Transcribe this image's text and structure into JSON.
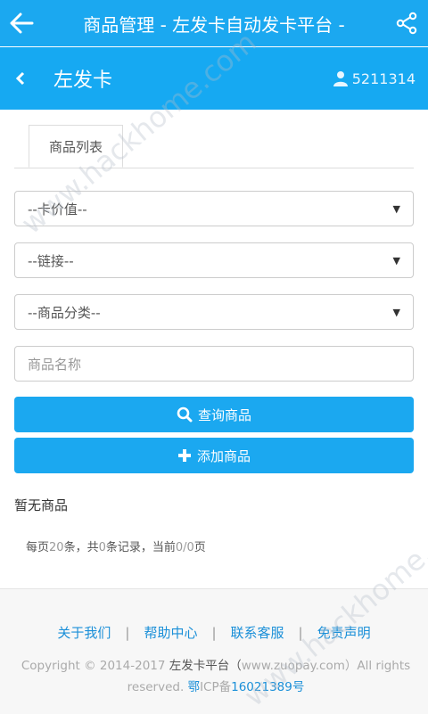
{
  "topbar": {
    "title": "商品管理 - 左发卡自动发卡平台 -"
  },
  "subbar": {
    "brand": "左发卡",
    "user_id": "5211314"
  },
  "tabs": [
    {
      "label": "商品列表"
    }
  ],
  "filters": {
    "card_value": "--卡价值--",
    "link": "--链接--",
    "category": "--商品分类--",
    "name_placeholder": "商品名称"
  },
  "buttons": {
    "query": "查询商品",
    "add": "添加商品"
  },
  "empty_text": "暂无商品",
  "pager": {
    "p1": "每页",
    "per_page": "20",
    "p2": "条，共",
    "total": "0",
    "p3": "条记录，当前",
    "current": "0/0",
    "p4": "页"
  },
  "footer": {
    "links": [
      "关于我们",
      "帮助中心",
      "联系客服",
      "免责声明"
    ],
    "separator": "|",
    "copyright_a": "Copyright © 2014-2017 ",
    "copyright_b": "左发卡平台（",
    "copyright_c": "www.zuopay.com）All rights reserved. ",
    "icp_a": "鄂",
    "icp_b": "ICP备",
    "icp_c": "16021389号"
  },
  "watermarks": [
    "www.hackhome.com",
    "www.hackhome.com"
  ],
  "colors": {
    "primary": "#1ba8f0",
    "link": "#1a8fd8"
  }
}
